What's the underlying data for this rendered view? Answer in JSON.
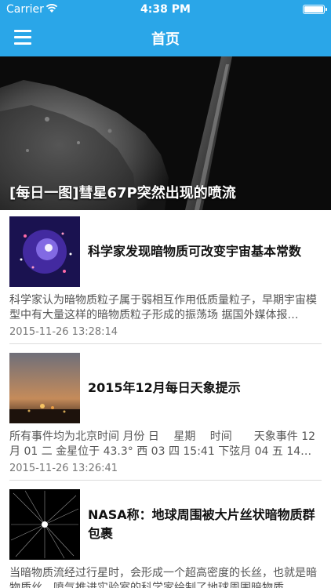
{
  "status_bar": {
    "carrier": "Carrier",
    "time": "4:38 PM"
  },
  "nav": {
    "title": "首页"
  },
  "hero": {
    "title": "[每日一图]彗星67P突然出现的喷流"
  },
  "articles": [
    {
      "title": "科学家发现暗物质可改变宇宙基本常数",
      "summary": "科学家认为暗物质粒子属于弱相互作用低质量粒子，早期宇宙模型中有大量这样的暗物质粒子形成的振荡场 据国外媒体报…",
      "date": "2015-11-26 13:28:14"
    },
    {
      "title": "2015年12月每日天象提示",
      "summary": "所有事件均为北京时间 月份 日　 星期　 时间　　天象事件 12月 01 二 金星位于 43.3° 西 03 四 15:41 下弦月 04 五 14…",
      "date": "2015-11-26 13:26:41"
    },
    {
      "title": "NASA称：地球周围被大片丝状暗物质群包裹",
      "summary": "当暗物质流经过行星时，会形成一个超高密度的长丝，也就是暗物质丝。喷气推进实验室的科学家绘制了地球周围暗物质",
      "date": ""
    }
  ],
  "colors": {
    "nav_background": "#2aa6e8",
    "title_text": "#111111",
    "summary_text": "#555555",
    "date_text": "#777777"
  },
  "icons": {
    "menu": "hamburger-menu-icon",
    "wifi": "wifi-icon",
    "battery": "battery-icon"
  }
}
